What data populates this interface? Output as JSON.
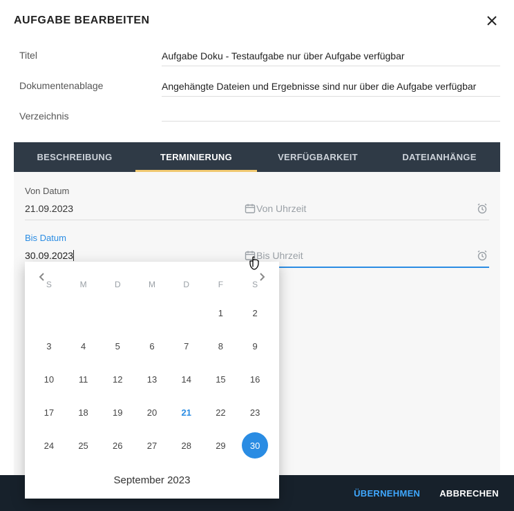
{
  "header": {
    "title": "AUFGABE BEARBEITEN"
  },
  "form": {
    "title_label": "Titel",
    "title_value": "Aufgabe Doku - Testaufgabe nur über Aufgabe verfügbar",
    "docstore_label": "Dokumentenablage",
    "docstore_value": "Angehängte Dateien und Ergebnisse sind nur über die Aufgabe verfügbar",
    "directory_label": "Verzeichnis",
    "directory_value": ""
  },
  "tabs": {
    "description": "BESCHREIBUNG",
    "scheduling": "TERMINIERUNG",
    "availability": "VERFÜGBARKEIT",
    "attachments": "DATEIANHÄNGE"
  },
  "dates": {
    "from_label": "Von Datum",
    "from_value": "21.09.2023",
    "from_time_placeholder": "Von Uhrzeit",
    "to_label": "Bis Datum",
    "to_value": "30.09.2023",
    "to_time_placeholder": "Bis Uhrzeit"
  },
  "calendar": {
    "dow": [
      "S",
      "M",
      "D",
      "M",
      "D",
      "F",
      "S"
    ],
    "days": [
      "",
      "",
      "",
      "",
      "",
      "1",
      "2",
      "3",
      "4",
      "5",
      "6",
      "7",
      "8",
      "9",
      "10",
      "11",
      "12",
      "13",
      "14",
      "15",
      "16",
      "17",
      "18",
      "19",
      "20",
      "21",
      "22",
      "23",
      "24",
      "25",
      "26",
      "27",
      "28",
      "29",
      "30"
    ],
    "highlight": "21",
    "selected": "30",
    "title": "September 2023"
  },
  "footer": {
    "ok": "ÜBERNEHMEN",
    "cancel": "ABBRECHEN"
  }
}
